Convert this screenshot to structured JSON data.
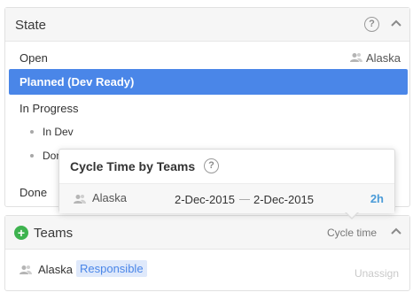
{
  "state_panel": {
    "title": "State",
    "help_icon": "?",
    "collapse_icon": "chevron-up-icon",
    "items": [
      {
        "label": "Open",
        "team": "Alaska"
      },
      {
        "label": "Planned (Dev Ready)",
        "selected": true
      },
      {
        "label": "In Progress"
      },
      {
        "label": "In Dev"
      },
      {
        "label": "Done"
      },
      {
        "label": "Done"
      }
    ]
  },
  "teams_panel": {
    "title": "Teams",
    "add_icon": "+",
    "cycle_time_link": "Cycle time",
    "team": {
      "name": "Alaska",
      "role": "Responsible",
      "unassign": "Unassign"
    }
  },
  "popup": {
    "title": "Cycle Time by Teams",
    "help_icon": "?",
    "row": {
      "team": "Alaska",
      "start": "2-Dec-2015",
      "end": "2-Dec-2015",
      "duration": "2h"
    }
  },
  "colors": {
    "selected": "#4a86e8",
    "add": "#3eb34f",
    "duration": "#4a9bd8",
    "badge_bg": "#dfe9fb"
  }
}
